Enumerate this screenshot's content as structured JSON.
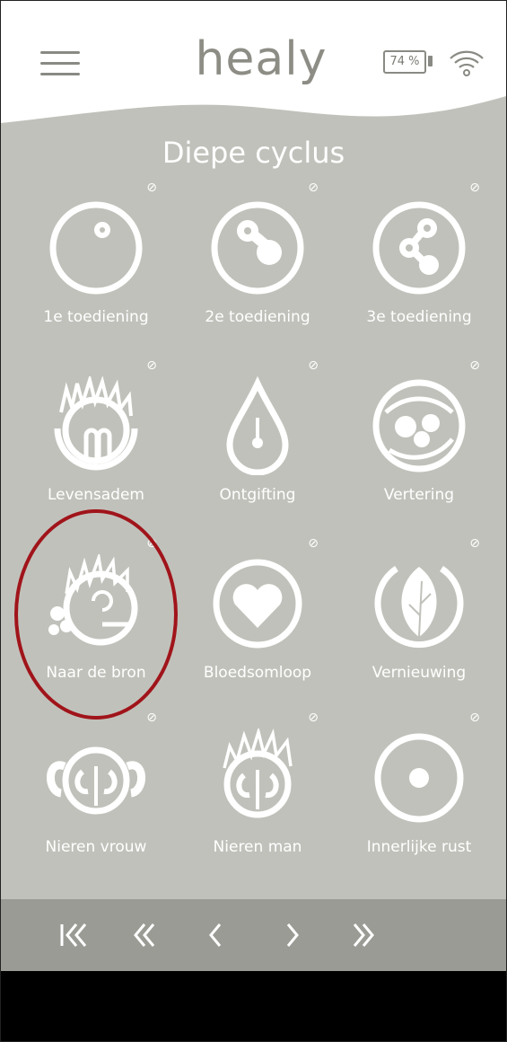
{
  "header": {
    "logo_text": "healy",
    "battery_label": "74 %",
    "battery_level": 0.74
  },
  "page": {
    "title": "Diepe cyclus"
  },
  "programs": [
    {
      "label": "1e toediening",
      "icon": "cell-one-dot-icon",
      "link_icon": "link-icon"
    },
    {
      "label": "2e toediening",
      "icon": "cell-two-dots-icon",
      "link_icon": "link-icon"
    },
    {
      "label": "3e toediening",
      "icon": "cell-three-dots-icon",
      "link_icon": "link-icon"
    },
    {
      "label": "Levensadem",
      "icon": "lungs-icon",
      "link_icon": "link-icon"
    },
    {
      "label": "Ontgifting",
      "icon": "drop-icon",
      "link_icon": "link-icon"
    },
    {
      "label": "Vertering",
      "icon": "digestion-icon",
      "link_icon": "link-icon"
    },
    {
      "label": "Naar de bron",
      "icon": "spiral-sun-icon",
      "link_icon": "link-icon"
    },
    {
      "label": "Bloedsomloop",
      "icon": "heart-icon",
      "link_icon": "link-icon"
    },
    {
      "label": "Vernieuwing",
      "icon": "leaf-icon",
      "link_icon": "link-icon"
    },
    {
      "label": "Nieren vrouw",
      "icon": "kidneys-female-icon",
      "link_icon": "link-icon"
    },
    {
      "label": "Nieren man",
      "icon": "kidneys-male-icon",
      "link_icon": "link-icon"
    },
    {
      "label": "Innerlijke rust",
      "icon": "circle-dot-icon",
      "link_icon": "link-icon"
    }
  ],
  "pagination": {
    "buttons": [
      "first-page-icon",
      "fast-back-icon",
      "back-icon",
      "forward-icon",
      "fast-forward-icon"
    ]
  },
  "colors": {
    "content_bg": "#c1c1bb",
    "nav_bg": "#9b9b95",
    "highlight": "#a0141a",
    "logo": "#8d8d86"
  }
}
